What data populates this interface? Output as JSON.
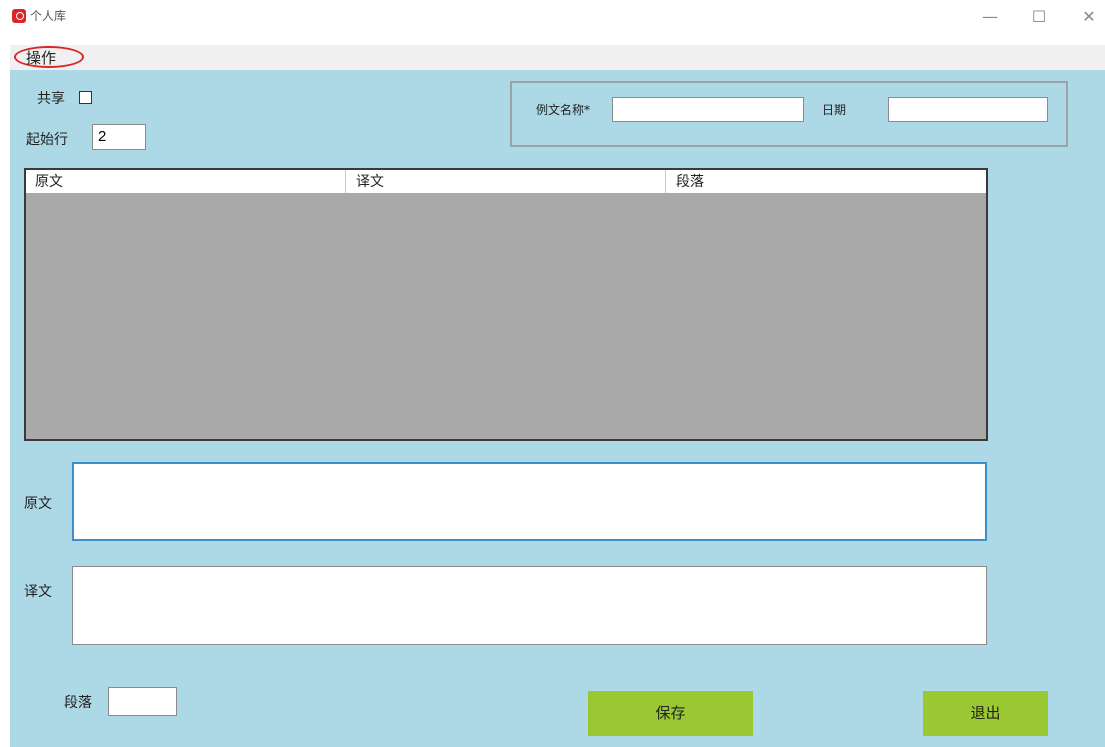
{
  "window": {
    "title": "个人库",
    "controls": {
      "minimize": "—",
      "maximize": "☐",
      "close": "✕"
    }
  },
  "menu": {
    "items": [
      {
        "label": "操作"
      }
    ]
  },
  "form": {
    "share_label": "共享",
    "share_checked": false,
    "start_row_label": "起始行",
    "start_row_value": "2",
    "doc_name_label": "例文名称*",
    "doc_name_value": "",
    "date_label": "日期",
    "date_value": ""
  },
  "grid": {
    "columns": [
      "原文",
      "译文",
      "段落"
    ],
    "rows": []
  },
  "editor": {
    "source_label": "原文",
    "source_value": "",
    "target_label": "译文",
    "target_value": "",
    "paragraph_label": "段落",
    "paragraph_value": ""
  },
  "actions": {
    "save_label": "保存",
    "exit_label": "退出"
  },
  "colors": {
    "background": "#add8e6",
    "button": "#9ac832",
    "menu_highlight": "#d9262b",
    "grid_body": "#a9a9a9"
  }
}
